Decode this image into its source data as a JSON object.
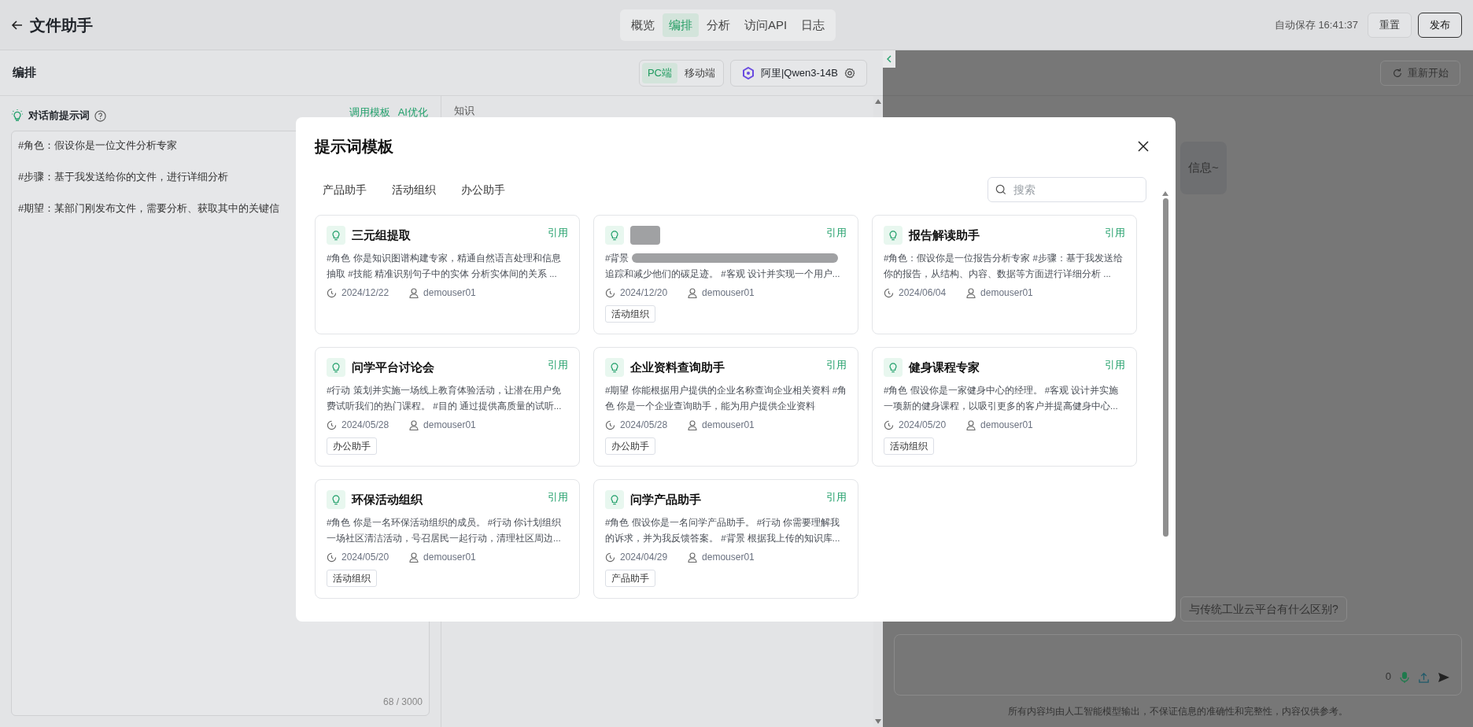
{
  "header": {
    "title": "文件助手",
    "tabs": [
      {
        "label": "概览",
        "selected": false
      },
      {
        "label": "编排",
        "selected": true
      },
      {
        "label": "分析",
        "selected": false
      },
      {
        "label": "访问API",
        "selected": false
      },
      {
        "label": "日志",
        "selected": false
      }
    ],
    "autosave": "自动保存 16:41:37",
    "buttons": [
      {
        "label": "重置",
        "kind": "default"
      },
      {
        "label": "发布",
        "kind": "primary"
      }
    ]
  },
  "toolbar": {
    "title": "编排",
    "devices": [
      {
        "label": "PC端",
        "selected": true
      },
      {
        "label": "移动端",
        "selected": false
      }
    ],
    "model": "阿里|Qwen3-14B"
  },
  "prompt_panel": {
    "title": "对话前提示词",
    "links": [
      "调用模板",
      "AI优化"
    ],
    "text": "#角色：假设你是一位文件分析专家\n\n#步骤：基于我发送给你的文件，进行详细分析\n\n#期望：某部门刚发布文件，需要分析、获取其中的关键信",
    "counter": "68 / 3000"
  },
  "knowledge_panel": {
    "title": "知识"
  },
  "chat": {
    "restart": "重新开始",
    "bubble": "信息~",
    "suggestion": "与传统工业云平台有什么区别?",
    "input_count": "0",
    "disclaimer": "所有内容均由人工智能模型输出，不保证信息的准确性和完整性，内容仅供参考。"
  },
  "modal": {
    "title": "提示词模板",
    "categories": [
      "产品助手",
      "活动组织",
      "办公助手"
    ],
    "search": {
      "placeholder": "搜索"
    },
    "cards": [
      {
        "title": "三元组提取",
        "redacted": false,
        "action": "引用",
        "description": "#角色 你是知识图谱构建专家，精通自然语言处理和信息抽取 #技能 精准识别句子中的实体 分析实体间的关系 ...",
        "date": "2024/12/22",
        "user": "demouser01"
      },
      {
        "redacted": true,
        "action": "引用",
        "description_prefix": "#背景",
        "description": "追踪和减少他们的碳足迹。 #客观 设计并实现一个用户...",
        "date": "2024/12/20",
        "user": "demouser01",
        "tag": "活动组织"
      },
      {
        "title": "报告解读助手",
        "redacted": false,
        "action": "引用",
        "description": "#角色：假设你是一位报告分析专家 #步骤：基于我发送给你的报告，从结构、内容、数据等方面进行详细分析 ...",
        "date": "2024/06/04",
        "user": "demouser01"
      },
      {
        "title": "问学平台讨论会",
        "redacted": false,
        "action": "引用",
        "description": "#行动 策划并实施一场线上教育体验活动，让潜在用户免费试听我们的热门课程。 #目的 通过提供高质量的试听...",
        "date": "2024/05/28",
        "user": "demouser01",
        "tag": "办公助手"
      },
      {
        "title": "企业资料查询助手",
        "redacted": false,
        "action": "引用",
        "description": "#期望 你能根据用户提供的企业名称查询企业相关资料 #角色 你是一个企业查询助手，能为用户提供企业资料",
        "date": "2024/05/28",
        "user": "demouser01",
        "tag": "办公助手"
      },
      {
        "title": "健身课程专家",
        "redacted": false,
        "action": "引用",
        "description": "#角色 假设你是一家健身中心的经理。 #客观 设计并实施一项新的健身课程，以吸引更多的客户并提高健身中心...",
        "date": "2024/05/20",
        "user": "demouser01",
        "tag": "活动组织"
      },
      {
        "title": "环保活动组织",
        "redacted": false,
        "action": "引用",
        "description": "#角色 你是一名环保活动组织的成员。 #行动 你计划组织一场社区清洁活动，号召居民一起行动，清理社区周边...",
        "date": "2024/05/20",
        "user": "demouser01",
        "tag": "活动组织"
      },
      {
        "title": "问学产品助手",
        "redacted": false,
        "action": "引用",
        "description": "#角色 假设你是一名问学产品助手。 #行动 你需要理解我的诉求，并为我反馈答案。 #背景 根据我上传的知识库...",
        "date": "2024/04/29",
        "user": "demouser01",
        "tag": "产品助手"
      }
    ]
  }
}
